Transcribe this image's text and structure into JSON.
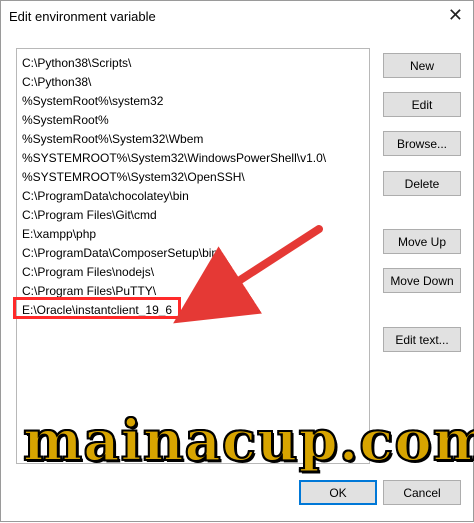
{
  "window": {
    "title": "Edit environment variable",
    "close_glyph": "✕"
  },
  "paths": [
    "C:\\Python38\\Scripts\\",
    "C:\\Python38\\",
    "%SystemRoot%\\system32",
    "%SystemRoot%",
    "%SystemRoot%\\System32\\Wbem",
    "%SYSTEMROOT%\\System32\\WindowsPowerShell\\v1.0\\",
    "%SYSTEMROOT%\\System32\\OpenSSH\\",
    "C:\\ProgramData\\chocolatey\\bin",
    "C:\\Program Files\\Git\\cmd",
    "E:\\xampp\\php",
    "C:\\ProgramData\\ComposerSetup\\bin",
    "C:\\Program Files\\nodejs\\",
    "C:\\Program Files\\PuTTY\\",
    "E:\\Oracle\\instantclient_19_6"
  ],
  "buttons": {
    "new": "New",
    "edit": "Edit",
    "browse": "Browse...",
    "delete": "Delete",
    "move_up": "Move Up",
    "move_down": "Move Down",
    "edit_text": "Edit text...",
    "ok": "OK",
    "cancel": "Cancel"
  },
  "annotation": {
    "highlight_color": "#ff2a2a",
    "arrow_color": "#e53935"
  },
  "watermark": {
    "text": "mainacup.com",
    "color": "#d7a400"
  }
}
